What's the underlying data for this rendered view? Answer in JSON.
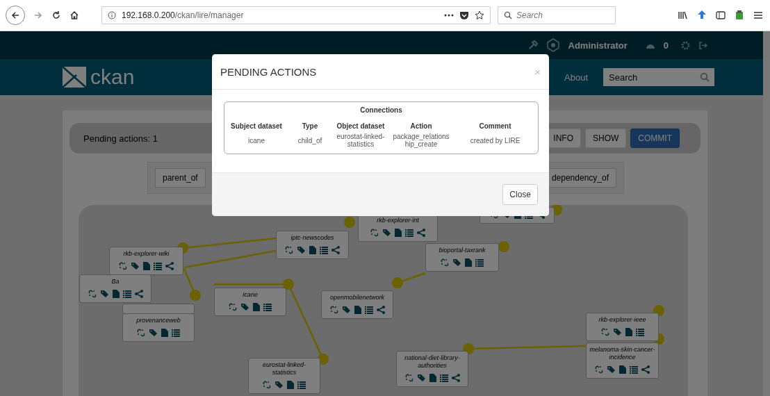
{
  "browser": {
    "url_host": "192.168.0.200",
    "url_path": "/ckan/lire/manager",
    "search_placeholder": "Search"
  },
  "account": {
    "user": "Administrator",
    "count": "0"
  },
  "site": {
    "logo": "ckan",
    "nav": [
      "About"
    ],
    "search_placeholder": "Search"
  },
  "pending": {
    "label": "Pending actions:",
    "count": "1",
    "buttons": [
      {
        "label": "INFO",
        "kind": "default"
      },
      {
        "label": "SHOW",
        "kind": "default"
      },
      {
        "label": "COMMIT",
        "kind": "primary"
      }
    ]
  },
  "relation_types": [
    {
      "label": "parent_of"
    },
    {
      "label": "dependency_of"
    }
  ],
  "graph": {
    "nodes": [
      {
        "label": "rkb-explorer-int",
        "share": true
      },
      {
        "share": true
      },
      {
        "label": "iptc-newscodes",
        "share": true
      },
      {
        "label": "Ba",
        "share": true
      },
      {
        "label": "rkb-explorer-wiki",
        "share": true
      },
      {
        "covered": true
      },
      {
        "label": "provenanceweb",
        "share": false
      },
      {
        "label": "icane",
        "share": false
      },
      {
        "label": "openmobilenetwork",
        "share": true
      },
      {
        "label": "bioportal-taxrank",
        "share": false
      },
      {
        "label": "rkb-explorer-ieee",
        "share": false
      },
      {
        "label": "melanoma-skin-cancer-incidence",
        "share": true
      },
      {
        "label": "national-diet-library-authorities",
        "share": true
      },
      {
        "label": "eurostat-linked-statistics",
        "share": false
      }
    ]
  },
  "modal": {
    "title": "PENDING ACTIONS",
    "close": "×",
    "table": {
      "caption": "Connections",
      "columns": [
        "Subject dataset",
        "Type",
        "Object dataset",
        "Action",
        "Comment"
      ],
      "rows": [
        [
          "icane",
          "child_of",
          "eurostat-linked-statistics",
          "package_relationship_create",
          "created by LIRE"
        ]
      ]
    },
    "buttons": [
      "Close"
    ]
  }
}
